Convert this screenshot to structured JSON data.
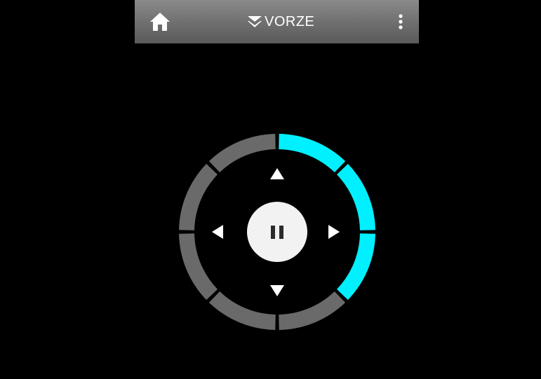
{
  "app_bar": {
    "brand": "VORZE",
    "home_icon": "home-icon",
    "menu_icon": "more-vert-icon",
    "brand_icon": "vorze-chevron-logo-icon"
  },
  "controller": {
    "center_button": {
      "state": "playing",
      "icon": "pause-icon"
    },
    "arrows": [
      "up",
      "down",
      "left",
      "right"
    ],
    "ring": {
      "segment_count": 8,
      "active_segments": 3,
      "active_fraction": 0.375
    }
  },
  "colors": {
    "background": "#000000",
    "app_bar": "#6e6e6e",
    "ring_active": "#00f0ff",
    "ring_inactive": "#6a6a6a",
    "center_button": "#f2f2f2",
    "pause_icon": "#2b2b2b",
    "arrow": "#ffffff"
  }
}
